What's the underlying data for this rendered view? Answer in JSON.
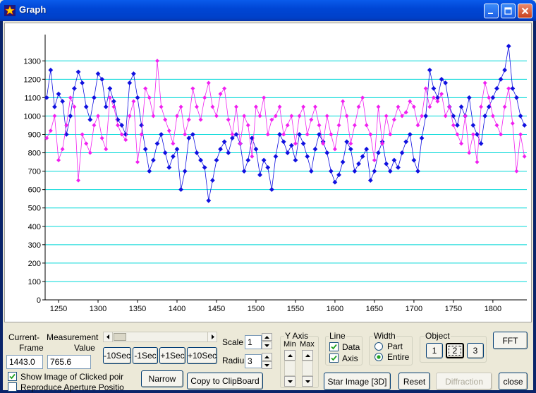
{
  "window": {
    "title": "Graph"
  },
  "icons": {
    "app": "app-star-icon",
    "minimize": "minimize-icon",
    "maximize": "maximize-icon",
    "close": "close-icon"
  },
  "chart_data": {
    "type": "scatter",
    "title": "",
    "xlabel": "",
    "ylabel": "",
    "xlim": [
      1233,
      1843
    ],
    "ylim": [
      0,
      1420
    ],
    "xticks": [
      1250,
      1300,
      1350,
      1400,
      1450,
      1500,
      1550,
      1600,
      1650,
      1700,
      1750,
      1800
    ],
    "yticks": [
      0,
      100,
      200,
      300,
      400,
      500,
      600,
      700,
      800,
      900,
      1000,
      1100,
      1200,
      1300
    ],
    "grid": {
      "horizontal": true,
      "color": "#00D8D8"
    },
    "series": [
      {
        "color": "#1010E0",
        "x": [
          1235,
          1240,
          1245,
          1250,
          1255,
          1260,
          1265,
          1270,
          1275,
          1280,
          1285,
          1290,
          1295,
          1300,
          1305,
          1310,
          1315,
          1320,
          1325,
          1330,
          1335,
          1340,
          1345,
          1350,
          1355,
          1360,
          1365,
          1370,
          1375,
          1380,
          1385,
          1390,
          1395,
          1400,
          1405,
          1410,
          1415,
          1420,
          1425,
          1430,
          1435,
          1440,
          1445,
          1450,
          1455,
          1460,
          1465,
          1470,
          1475,
          1480,
          1485,
          1490,
          1495,
          1500,
          1505,
          1510,
          1515,
          1520,
          1525,
          1530,
          1535,
          1540,
          1545,
          1550,
          1555,
          1560,
          1565,
          1570,
          1575,
          1580,
          1585,
          1590,
          1595,
          1600,
          1605,
          1610,
          1615,
          1620,
          1625,
          1630,
          1635,
          1640,
          1645,
          1650,
          1655,
          1660,
          1665,
          1670,
          1675,
          1680,
          1685,
          1690,
          1695,
          1700,
          1705,
          1710,
          1715,
          1720,
          1725,
          1730,
          1735,
          1740,
          1745,
          1750,
          1755,
          1760,
          1765,
          1770,
          1775,
          1780,
          1785,
          1790,
          1795,
          1800,
          1805,
          1810,
          1815,
          1820,
          1825,
          1830,
          1835,
          1840
        ],
        "y": [
          1100,
          1250,
          1050,
          1120,
          1080,
          900,
          1000,
          1150,
          1240,
          1180,
          1050,
          980,
          1100,
          1230,
          1200,
          1050,
          1150,
          1080,
          980,
          950,
          900,
          1180,
          1230,
          1100,
          950,
          820,
          700,
          760,
          850,
          900,
          800,
          720,
          780,
          820,
          600,
          700,
          880,
          900,
          800,
          760,
          720,
          540,
          650,
          760,
          820,
          860,
          800,
          880,
          900,
          850,
          700,
          760,
          880,
          820,
          680,
          760,
          720,
          600,
          780,
          900,
          860,
          800,
          840,
          760,
          900,
          850,
          780,
          700,
          820,
          900,
          860,
          800,
          700,
          640,
          680,
          750,
          860,
          820,
          700,
          740,
          780,
          820,
          650,
          700,
          800,
          860,
          740,
          700,
          760,
          720,
          800,
          860,
          900,
          760,
          700,
          880,
          1000,
          1250,
          1150,
          1100,
          1200,
          1180,
          1050,
          1000,
          950,
          1050,
          1000,
          1100,
          950,
          900,
          850,
          1000,
          1050,
          1100,
          1150,
          1200,
          1250,
          1380,
          1150,
          1100,
          1000,
          950
        ]
      },
      {
        "color": "#F020F0",
        "x": [
          1235,
          1240,
          1245,
          1250,
          1255,
          1260,
          1265,
          1270,
          1275,
          1280,
          1285,
          1290,
          1295,
          1300,
          1305,
          1310,
          1315,
          1320,
          1325,
          1330,
          1335,
          1340,
          1345,
          1350,
          1355,
          1360,
          1365,
          1370,
          1375,
          1380,
          1385,
          1390,
          1395,
          1400,
          1405,
          1410,
          1415,
          1420,
          1425,
          1430,
          1435,
          1440,
          1445,
          1450,
          1455,
          1460,
          1465,
          1470,
          1475,
          1480,
          1485,
          1490,
          1495,
          1500,
          1505,
          1510,
          1515,
          1520,
          1525,
          1530,
          1535,
          1540,
          1545,
          1550,
          1555,
          1560,
          1565,
          1570,
          1575,
          1580,
          1585,
          1590,
          1595,
          1600,
          1605,
          1610,
          1615,
          1620,
          1625,
          1630,
          1635,
          1640,
          1645,
          1650,
          1655,
          1660,
          1665,
          1670,
          1675,
          1680,
          1685,
          1690,
          1695,
          1700,
          1705,
          1710,
          1715,
          1720,
          1725,
          1730,
          1735,
          1740,
          1745,
          1750,
          1755,
          1760,
          1765,
          1770,
          1775,
          1780,
          1785,
          1790,
          1795,
          1800,
          1805,
          1810,
          1815,
          1820,
          1825,
          1830,
          1835,
          1840
        ],
        "y": [
          880,
          920,
          1000,
          760,
          820,
          950,
          1100,
          1050,
          650,
          900,
          850,
          800,
          950,
          1000,
          880,
          820,
          1100,
          1050,
          950,
          900,
          870,
          1000,
          1080,
          750,
          900,
          1150,
          1100,
          1000,
          1300,
          1050,
          980,
          920,
          850,
          1000,
          1050,
          900,
          980,
          1150,
          1050,
          980,
          1100,
          1180,
          1050,
          1000,
          1120,
          1150,
          980,
          900,
          1050,
          850,
          1000,
          950,
          780,
          1050,
          1000,
          1100,
          900,
          980,
          1000,
          1050,
          900,
          950,
          1000,
          850,
          1000,
          1050,
          900,
          980,
          1050,
          950,
          850,
          1000,
          900,
          820,
          950,
          1080,
          1000,
          850,
          950,
          1050,
          1100,
          950,
          900,
          760,
          1050,
          850,
          1000,
          900,
          980,
          1050,
          1000,
          1020,
          1080,
          1050,
          950,
          1000,
          1150,
          1050,
          1100,
          1080,
          1120,
          1000,
          1050,
          950,
          900,
          850,
          1000,
          800,
          900,
          750,
          1050,
          1180,
          1100,
          1000,
          950,
          900,
          1050,
          1150,
          960,
          700,
          900,
          780
        ]
      }
    ]
  },
  "controls": {
    "current_frame_label_1": "Current-",
    "current_frame_label_2": "Frame",
    "current_frame_value": "1443.0",
    "measurement_label_1": "Measurement",
    "measurement_label_2": "Value",
    "measurement_value": "765.6",
    "step_buttons": [
      "-10Sec",
      "-1Sec",
      "+1Sec",
      "+10Sec"
    ],
    "show_image_label": "Show Image of Clicked poir",
    "show_image_checked": true,
    "reproduce_label": "Reproduce Aperture Positio",
    "reproduce_checked": false,
    "narrow_label": "Narrow",
    "copy_label": "Copy to ClipBoard",
    "scale_label": "Scale",
    "scale_value": "1",
    "radius_label": "Radiu",
    "radius_value": "3",
    "y_axis_label": "Y Axis",
    "y_min_label": "Min",
    "y_max_label": "Max",
    "line_group_label": "Line",
    "data_label": "Data",
    "data_checked": true,
    "axis_label": "Axis",
    "axis_checked": true,
    "width_group_label": "Width",
    "part_label": "Part",
    "entire_label": "Entire",
    "width_selected": "Entire",
    "object_group_label": "Object",
    "object_buttons": [
      "1",
      "2",
      "3"
    ],
    "object_selected": "2",
    "fft_label": "FFT",
    "star_image_label": "Star Image [3D]",
    "reset_label": "Reset",
    "diffraction_label": "Diffraction",
    "close_label": "close"
  }
}
